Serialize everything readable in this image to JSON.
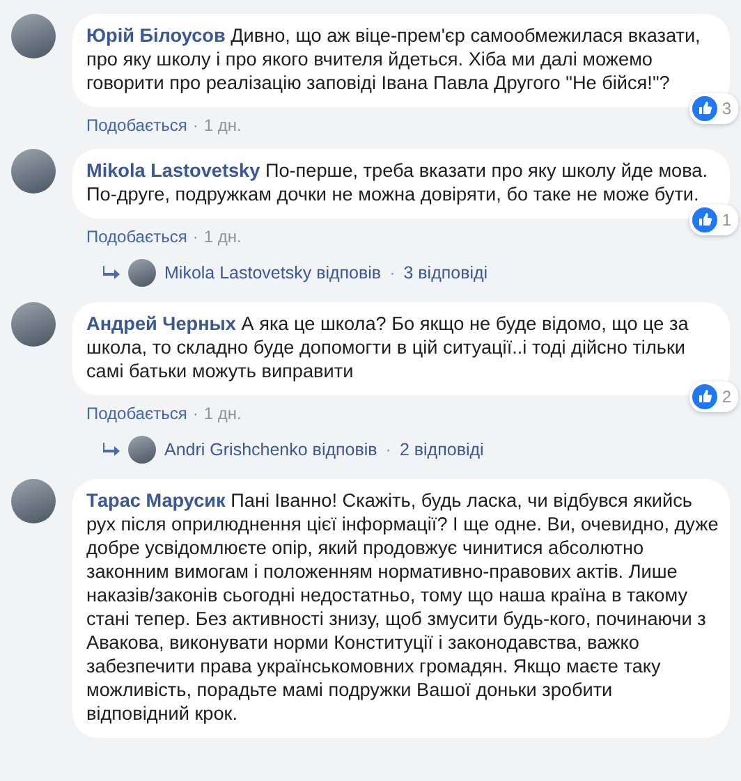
{
  "comments": [
    {
      "author": "Юрій Білоусов",
      "text": "Дивно, що аж віце-прем'єр самообмежилася вказати, про яку школу і про якого вчителя йдеться. Хіба ми далі можемо говорити про реалізацію заповіді Івана Павла Другого \"Не бійся!\"?",
      "like_label": "Подобається",
      "separator": "·",
      "time": "1 дн.",
      "reactions": "3"
    },
    {
      "author": "Mikola Lastovetsky",
      "text": "По-перше, треба вказати про яку школу йде мова. По-друге, подружкам дочки не можна довіряти, бо таке не може бути.",
      "like_label": "Подобається",
      "separator": "·",
      "time": "1 дн.",
      "reactions": "1",
      "replies": {
        "author": "Mikola Lastovetsky відповів",
        "separator": "·",
        "count": "3 відповіді"
      }
    },
    {
      "author": "Андрей Черных",
      "text": "А яка це школа? Бо якщо не буде відомо, що це за школа, то складно буде допомогти в цій ситуації..і тоді дійсно тільки самі батьки можуть виправити",
      "like_label": "Подобається",
      "separator": "·",
      "time": "1 дн.",
      "reactions": "2",
      "replies": {
        "author": "Andri Grishchenko відповів",
        "separator": "·",
        "count": "2 відповіді"
      }
    },
    {
      "author": "Тарас Марусик",
      "text": "Пані Іванно! Скажіть, будь ласка, чи відбувся якийсь рух після оприлюднення цієї інформації? І ще одне. Ви, очевидно, дуже добре усвідомлюєте опір, який продовжує чинитися абсолютно законним вимогам і положенням нормативно-правових актів. Лише наказів/законів сьогодні недостатньо, тому що наша країна в такому стані тепер. Без активності знизу, щоб змусити будь-кого, починаючи з Авакова, виконувати норми Конституції і законодавства, важко забезпечити права українськомовних громадян. Якщо маєте таку можливість, порадьте мамі подружки Вашої доньки зробити відповідний крок."
    }
  ]
}
